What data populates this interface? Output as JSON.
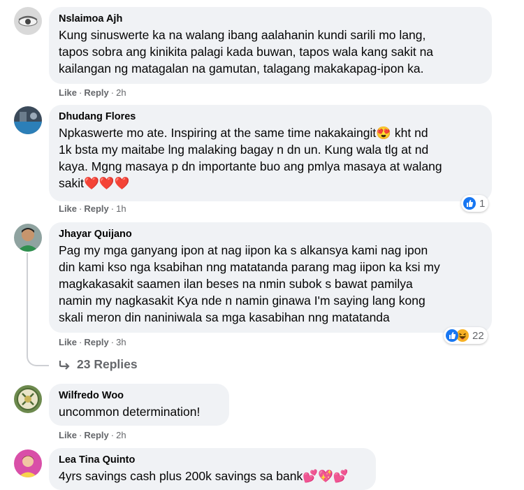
{
  "comments": [
    {
      "author": "Nslaimoa Ajh",
      "lines": [
        "Kung sinuswerte ka na walang ibang aalahanin kundi sarili mo lang,",
        "tapos sobra ang kinikita palagi kada buwan, tapos wala kang sakit na",
        "kailangan ng matagalan na gamutan, talagang makakapag-ipon ka."
      ],
      "like": "Like",
      "reply": "Reply",
      "time": "2h"
    },
    {
      "author": "Dhudang Flores",
      "lines": [
        "Npkaswerte mo ate. Inspiring at the same time nakakaingit😍 kht nd",
        "1k bsta my maitabe lng malaking bagay n dn un. Kung wala tlg at nd",
        "kaya. Mgng masaya p dn importante buo ang pmlya masaya at walang",
        "sakit❤️❤️❤️"
      ],
      "like": "Like",
      "reply": "Reply",
      "time": "1h",
      "reactions": {
        "icons": [
          "like-icon"
        ],
        "count": "1"
      }
    },
    {
      "author": "Jhayar Quijano",
      "lines": [
        "Pag my mga ganyang ipon at nag iipon ka s alkansya kami nag ipon",
        "din kami kso nga ksabihan nng matatanda parang mag iipon ka ksi my",
        "magkakasakit saamen ilan beses na nmin subok s bawat pamilya",
        "namin my nagkasakit Kya nde n namin ginawa I'm saying lang kong",
        "skali meron din naniniwala sa mga kasabihan nng matatanda"
      ],
      "like": "Like",
      "reply": "Reply",
      "time": "3h",
      "reactions": {
        "icons": [
          "like-icon",
          "laugh-icon"
        ],
        "count": "22"
      },
      "replies_label": "23 Replies"
    },
    {
      "author": "Wilfredo Woo",
      "lines": [
        "uncommon determination!"
      ],
      "like": "Like",
      "reply": "Reply",
      "time": "2h"
    },
    {
      "author": "Lea Tina Quinto",
      "lines": [
        "4yrs savings cash plus 200k savings sa bank💕💖💕"
      ]
    }
  ],
  "colors": {
    "bubble": "#f0f2f5",
    "meta": "#65676b",
    "like_blue": "#1877f2",
    "haha_yellow": "#f7b125"
  }
}
